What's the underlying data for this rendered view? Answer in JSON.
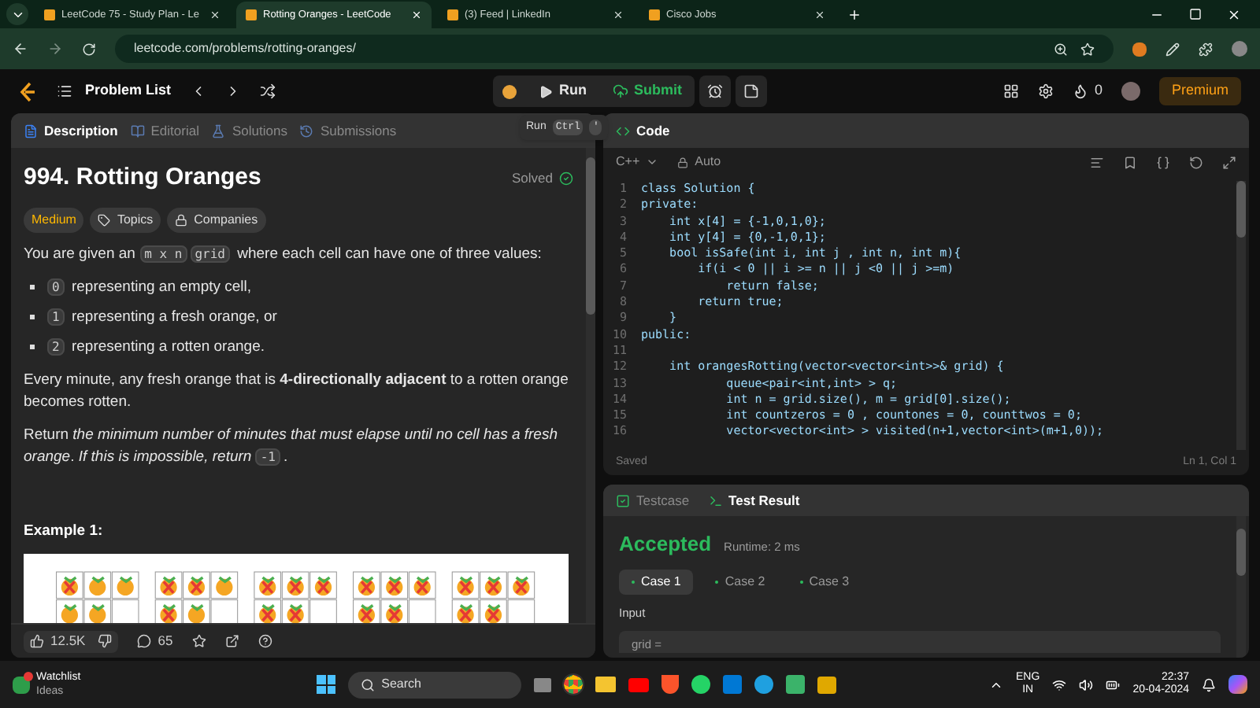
{
  "browser": {
    "tabs": [
      {
        "title": "LeetCode 75 - Study Plan - Le",
        "selected": false
      },
      {
        "title": "Rotting Oranges - LeetCode",
        "selected": true
      },
      {
        "title": "(3) Feed | LinkedIn",
        "selected": false
      },
      {
        "title": "Cisco Jobs",
        "selected": false
      }
    ],
    "url": "leetcode.com/problems/rotting-oranges/"
  },
  "header": {
    "problem_list": "Problem List",
    "run": "Run",
    "submit": "Submit",
    "streak": "0",
    "premium": "Premium"
  },
  "tooltip": {
    "label": "Run",
    "keys": [
      "Ctrl",
      "'"
    ]
  },
  "description": {
    "tabs": [
      {
        "label": "Description",
        "selected": true
      },
      {
        "label": "Editorial",
        "selected": false
      },
      {
        "label": "Solutions",
        "selected": false
      },
      {
        "label": "Submissions",
        "selected": false
      }
    ],
    "title": "994. Rotting Oranges",
    "status": "Solved",
    "difficulty": "Medium",
    "topics": "Topics",
    "companies": "Companies",
    "intro": [
      {
        "kind": "text",
        "text": "You are given an "
      },
      {
        "kind": "code",
        "text": "m x n"
      },
      {
        "kind": "code",
        "text": "grid"
      },
      {
        "kind": "text",
        "text": " where each cell can have one of three values:"
      }
    ],
    "bullets": [
      [
        {
          "kind": "code",
          "text": "0"
        },
        {
          "kind": "text",
          "text": " representing an empty cell,"
        }
      ],
      [
        {
          "kind": "code",
          "text": "1"
        },
        {
          "kind": "text",
          "text": " representing a fresh orange, or"
        }
      ],
      [
        {
          "kind": "code",
          "text": "2"
        },
        {
          "kind": "text",
          "text": " representing a rotten orange."
        }
      ]
    ],
    "rule": "Every minute, any fresh orange that is **4-directionally adjacent** to a rotten orange becomes rotten.",
    "task": [
      {
        "kind": "text",
        "text": "Return "
      },
      {
        "kind": "italic",
        "text": "the minimum number of minutes that must elapse until no cell has a fresh orange"
      },
      {
        "kind": "text",
        "text": ". "
      },
      {
        "kind": "italic",
        "text": "If this is impossible, return "
      },
      {
        "kind": "code",
        "text": "-1"
      },
      {
        "kind": "text",
        "text": "."
      }
    ],
    "example_heading": "Example 1:",
    "likes": "12.5K",
    "comments": "65"
  },
  "code": {
    "title": "Code",
    "language": "C++",
    "mode": "Auto",
    "status": "Saved",
    "cursor": "Ln 1, Col 1",
    "lines": [
      {
        "num": "1",
        "text": "class Solution {"
      },
      {
        "num": "2",
        "text": "private:"
      },
      {
        "num": "3",
        "text": "    int x[4] = {-1,0,1,0};"
      },
      {
        "num": "4",
        "text": "    int y[4] = {0,-1,0,1};"
      },
      {
        "num": "5",
        "text": "    bool isSafe(int i, int j , int n, int m){"
      },
      {
        "num": "6",
        "text": "        if(i < 0 || i >= n || j <0 || j >=m)"
      },
      {
        "num": "7",
        "text": "            return false;"
      },
      {
        "num": "8",
        "text": "        return true;"
      },
      {
        "num": "9",
        "text": "    }"
      },
      {
        "num": "10",
        "text": "public:"
      },
      {
        "num": "11"
      },
      {
        "num": "12",
        "text": "    int orangesRotting(vector<vector<int>>& grid) {"
      },
      {
        "num": "13",
        "text": "            queue<pair<int,int> > q;"
      },
      {
        "num": "14",
        "text": "            int n = grid.size(), m = grid[0].size();"
      },
      {
        "num": "15",
        "text": "            int countzeros = 0 , countones = 0, counttwos = 0;"
      },
      {
        "num": "16",
        "text": "            vector<vector<int> > visited(n+1,vector<int>(m+1,0));"
      }
    ]
  },
  "result": {
    "tabs": [
      {
        "label": "Testcase",
        "selected": false
      },
      {
        "label": "Test Result",
        "selected": true
      }
    ],
    "verdict": "Accepted",
    "runtime": "Runtime: 2 ms",
    "cases": [
      {
        "label": "Case 1",
        "selected": true
      },
      {
        "label": "Case 2",
        "selected": false
      },
      {
        "label": "Case 3",
        "selected": false
      }
    ],
    "input_label": "Input",
    "input_line": "grid ="
  },
  "taskbar": {
    "widget_title": "Watchlist",
    "widget_subtitle": "Ideas",
    "search": "Search",
    "lang": "ENG",
    "region": "IN",
    "time": "22:37",
    "date": "20-04-2024"
  }
}
